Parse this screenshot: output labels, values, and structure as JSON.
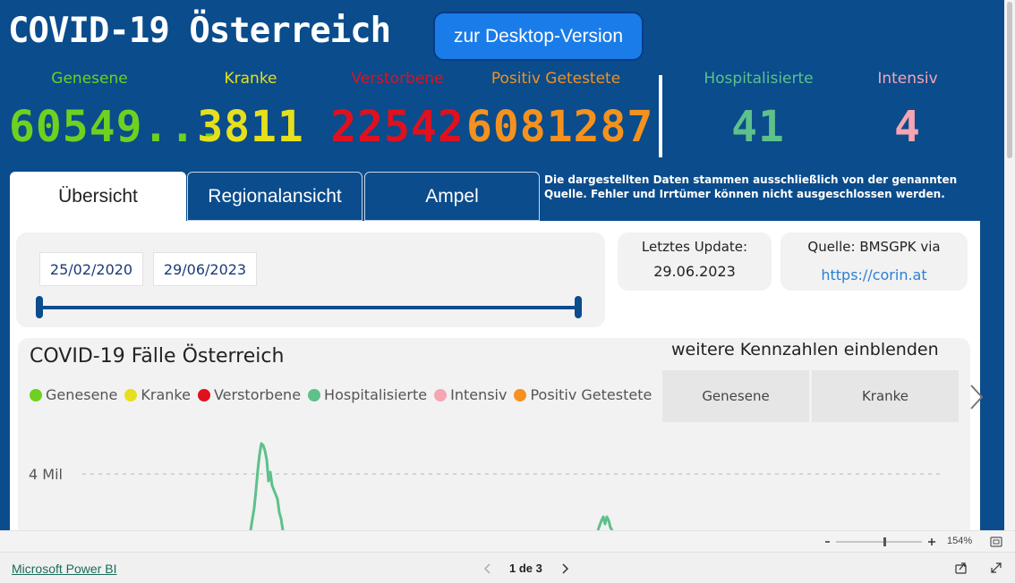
{
  "header": {
    "title": "COVID-19 Österreich",
    "desktop_button": "zur Desktop-Version"
  },
  "kpis": [
    {
      "label": "Genesene",
      "value": "60549...",
      "color": "#6ed11f"
    },
    {
      "label": "Kranke",
      "value": "3811",
      "color": "#e6e01c"
    },
    {
      "label": "Verstorbene",
      "value": "22542",
      "color": "#e0101e"
    },
    {
      "label": "Positiv Getestete",
      "value": "6081287",
      "color": "#f5911e"
    },
    {
      "label": "Hospitalisierte",
      "value": "41",
      "color": "#5ec08b"
    },
    {
      "label": "Intensiv",
      "value": "4",
      "color": "#f6a5b3"
    }
  ],
  "tabs": [
    {
      "label": "Übersicht"
    },
    {
      "label": "Regionalansicht"
    },
    {
      "label": "Ampel"
    }
  ],
  "disclaimer": "Die dargestellten Daten stammen ausschließlich von der genannten Quelle. Fehler und Irrtümer können nicht ausgeschlossen werden.",
  "date_filter": {
    "start": "25/02/2020",
    "end": "29/06/2023"
  },
  "update_card": {
    "label": "Letztes Update:",
    "value": "29.06.2023"
  },
  "source_card": {
    "label": "Quelle: BMSGPK via",
    "link": "https://corin.at"
  },
  "chart": {
    "title": "COVID-19 Fälle Österreich",
    "more_title": "weitere Kennzahlen einblenden",
    "slicer_buttons": [
      "Genesene",
      "Kranke"
    ],
    "legend": [
      {
        "name": "Genesene",
        "color": "#6ed11f"
      },
      {
        "name": "Kranke",
        "color": "#e6e01c"
      },
      {
        "name": "Verstorbene",
        "color": "#e0101e"
      },
      {
        "name": "Hospitalisierte",
        "color": "#5ec08b"
      },
      {
        "name": "Intensiv",
        "color": "#f6a5b3"
      },
      {
        "name": "Positiv Getestete",
        "color": "#f5911e"
      }
    ]
  },
  "chart_data": {
    "type": "line",
    "title": "COVID-19 Fälle Österreich",
    "y_tick_labels": [
      "4 Mil"
    ],
    "y_ticks": [
      4000000
    ],
    "gridlines": "dashed horizontal",
    "visible_series": [
      {
        "name": "Hospitalisierte",
        "color": "#5ec08b"
      }
    ]
  },
  "status": {
    "zoom": "154%",
    "page_indicator": "1 de 3",
    "powerbi_link": "Microsoft Power BI"
  }
}
